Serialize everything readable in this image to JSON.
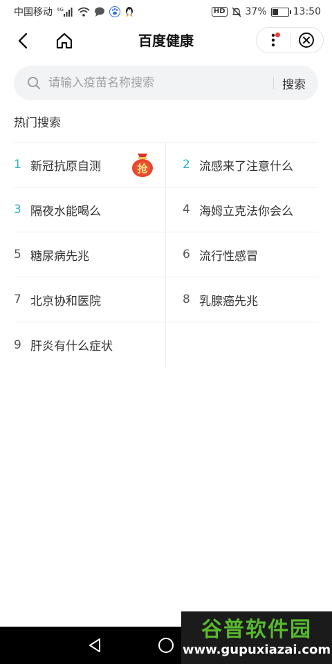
{
  "status_bar": {
    "carrier": "中国移动",
    "network": "4G",
    "hd": "HD",
    "battery_percent": "37%",
    "battery_level": 0.37,
    "time": "13:50"
  },
  "nav": {
    "title": "百度健康"
  },
  "search": {
    "placeholder": "请输入疫苗名称搜索",
    "value": "",
    "button_label": "搜索"
  },
  "hot_search": {
    "title": "热门搜索",
    "items": [
      {
        "rank": "1",
        "label": "新冠抗原自测",
        "highlight": true,
        "badge": "抢"
      },
      {
        "rank": "2",
        "label": "流感来了注意什么",
        "highlight": true
      },
      {
        "rank": "3",
        "label": "隔夜水能喝么",
        "highlight": true
      },
      {
        "rank": "4",
        "label": "海姆立克法你会么",
        "highlight": false
      },
      {
        "rank": "5",
        "label": "糖尿病先兆",
        "highlight": false
      },
      {
        "rank": "6",
        "label": "流行性感冒",
        "highlight": false
      },
      {
        "rank": "7",
        "label": "北京协和医院",
        "highlight": false
      },
      {
        "rank": "8",
        "label": "乳腺癌先兆",
        "highlight": false
      },
      {
        "rank": "9",
        "label": "肝炎有什么症状",
        "highlight": false
      }
    ]
  },
  "watermark": {
    "brand": "谷普软件园",
    "url": "www.gupuxiazai.com"
  },
  "colors": {
    "accent_rank": "#27b5c4",
    "badge_red": "#e8452c",
    "notification_dot": "#f23b3b"
  }
}
